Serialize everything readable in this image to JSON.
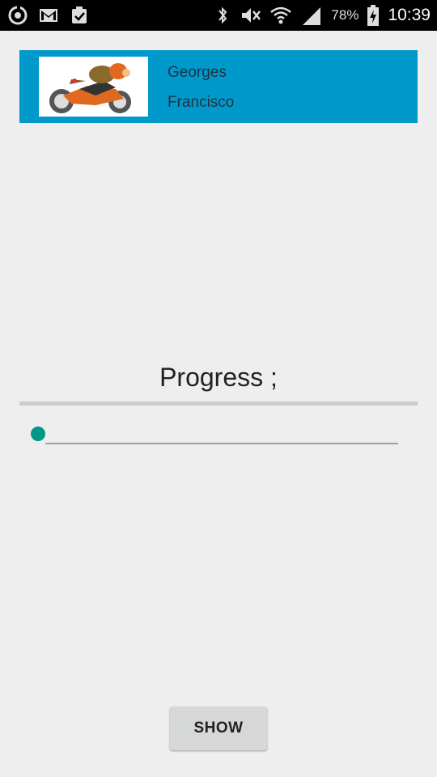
{
  "status_bar": {
    "battery_percent": "78%",
    "time": "10:39",
    "left_icons": [
      "sync-icon",
      "gmail-icon",
      "clipboard-check-icon"
    ],
    "right_icons": [
      "bluetooth-icon",
      "vibrate-mute-icon",
      "wifi-icon",
      "signal-icon",
      "battery-charging-icon"
    ]
  },
  "profile": {
    "first_name": "Georges",
    "last_name": "Francisco",
    "banner_color": "#0099cc"
  },
  "progress": {
    "label": "Progress ;",
    "value_fraction": 0,
    "accent_color": "#009688"
  },
  "actions": {
    "show_label": "SHOW"
  }
}
